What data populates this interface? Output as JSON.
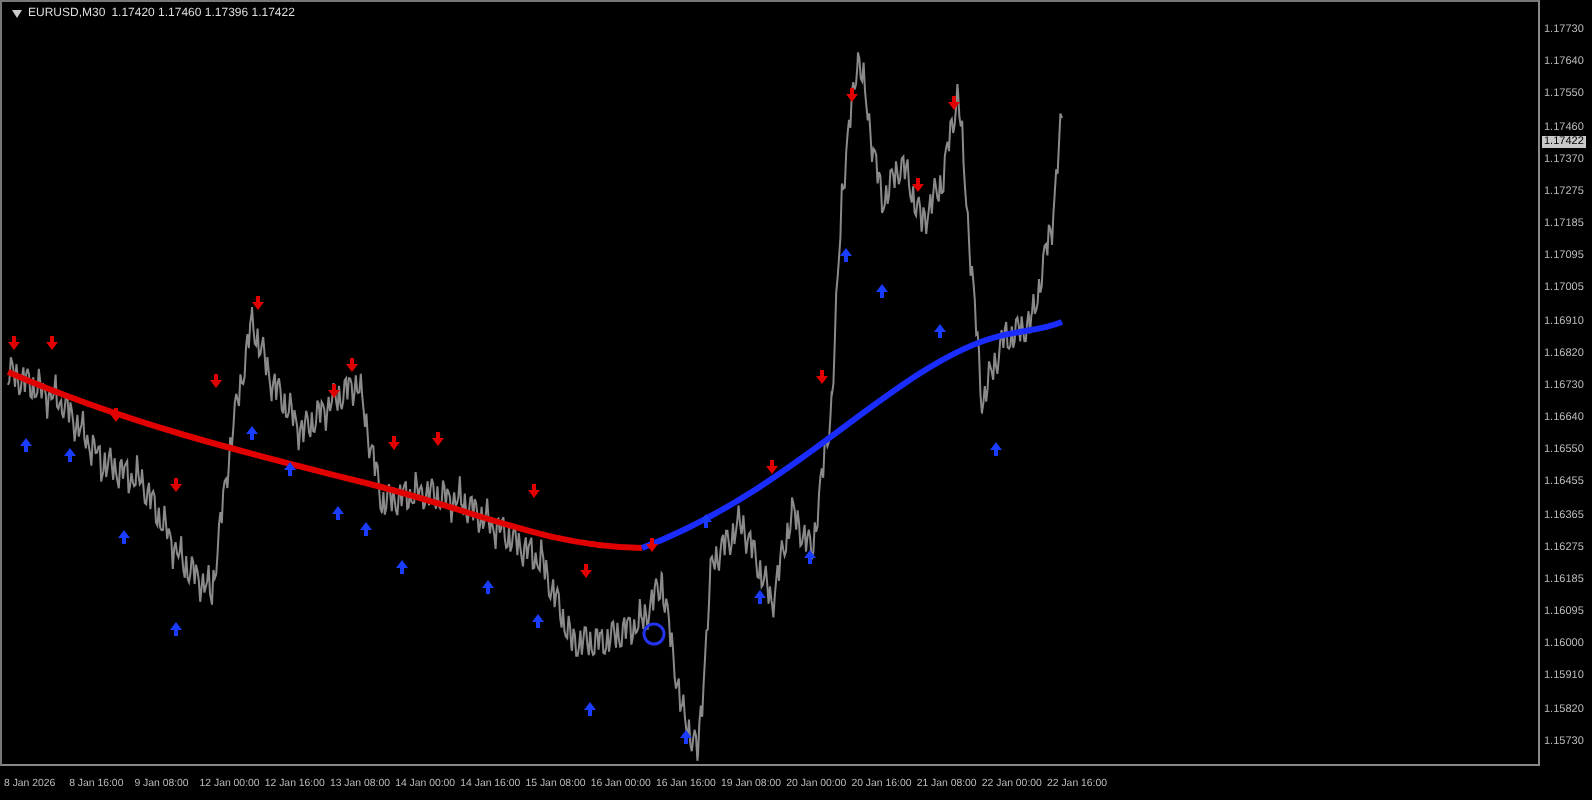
{
  "chart": {
    "symbol": "EURUSD,M30",
    "quotes": "1.17420 1.17460 1.17396 1.17422"
  },
  "price_axis": {
    "labels": [
      "1.17730",
      "1.17640",
      "1.17550",
      "1.17460",
      "1.17370",
      "1.17275",
      "1.17185",
      "1.17095",
      "1.17005",
      "1.16910",
      "1.16820",
      "1.16730",
      "1.16640",
      "1.16550",
      "1.16455",
      "1.16365",
      "1.16275",
      "1.16185",
      "1.16095",
      "1.16000",
      "1.15910",
      "1.15820",
      "1.15730"
    ],
    "current_price": "1.17422"
  },
  "time_axis": {
    "labels": [
      "8 Jan 2026",
      "8 Jan 16:00",
      "9 Jan 08:00",
      "12 Jan 00:00",
      "12 Jan 16:00",
      "13 Jan 08:00",
      "14 Jan 00:00",
      "14 Jan 16:00",
      "15 Jan 08:00",
      "16 Jan 00:00",
      "16 Jan 16:00",
      "19 Jan 08:00",
      "20 Jan 00:00",
      "20 Jan 16:00",
      "21 Jan 08:00",
      "22 Jan 00:00",
      "22 Jan 16:00"
    ]
  }
}
